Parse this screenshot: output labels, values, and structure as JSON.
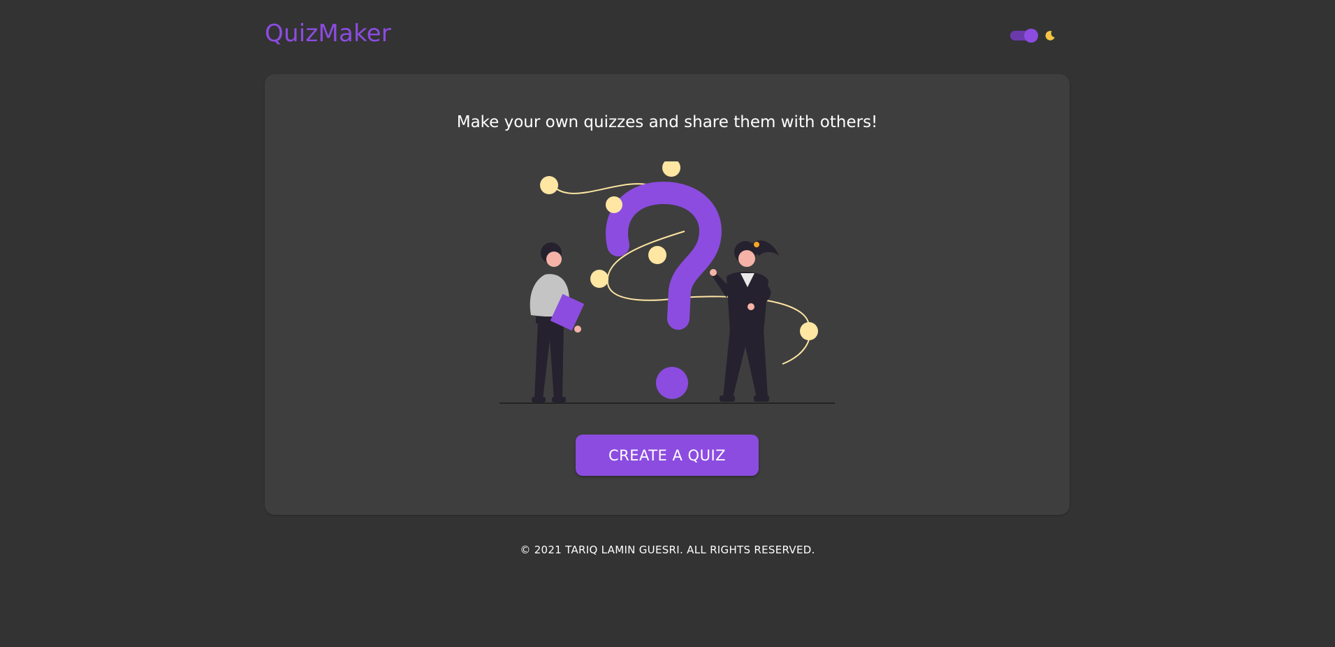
{
  "header": {
    "brand": "QuizMaker",
    "theme_toggle": {
      "state": "dark",
      "icon": "moon-icon"
    }
  },
  "main": {
    "tagline": "Make your own quizzes and share them with others!",
    "illustration": "question-mark-people-illustration",
    "cta_label": "CREATE A QUIZ"
  },
  "footer": {
    "copyright": "© 2021 TARIQ LAMIN GUESRI. ALL RIGHTS RESERVED."
  },
  "colors": {
    "background": "#333333",
    "card": "#3e3e3e",
    "accent": "#8c4ce0",
    "dot": "#ffe6a3",
    "figure_dark": "#26212e"
  }
}
